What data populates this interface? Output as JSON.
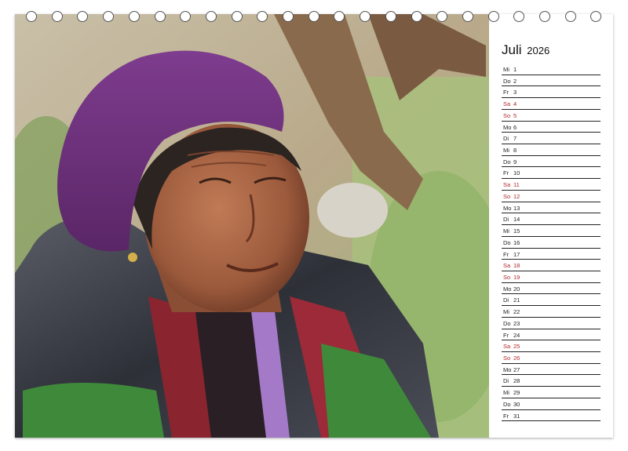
{
  "calendar": {
    "month": "Juli",
    "year": "2026",
    "days": [
      {
        "dn": "Mi",
        "d": "1",
        "weekend": false
      },
      {
        "dn": "Do",
        "d": "2",
        "weekend": false
      },
      {
        "dn": "Fr",
        "d": "3",
        "weekend": false
      },
      {
        "dn": "Sa",
        "d": "4",
        "weekend": true
      },
      {
        "dn": "So",
        "d": "5",
        "weekend": true
      },
      {
        "dn": "Mo",
        "d": "6",
        "weekend": false
      },
      {
        "dn": "Di",
        "d": "7",
        "weekend": false
      },
      {
        "dn": "Mi",
        "d": "8",
        "weekend": false
      },
      {
        "dn": "Do",
        "d": "9",
        "weekend": false
      },
      {
        "dn": "Fr",
        "d": "10",
        "weekend": false
      },
      {
        "dn": "Sa",
        "d": "11",
        "weekend": true
      },
      {
        "dn": "So",
        "d": "12",
        "weekend": true
      },
      {
        "dn": "Mo",
        "d": "13",
        "weekend": false
      },
      {
        "dn": "Di",
        "d": "14",
        "weekend": false
      },
      {
        "dn": "Mi",
        "d": "15",
        "weekend": false
      },
      {
        "dn": "Do",
        "d": "16",
        "weekend": false
      },
      {
        "dn": "Fr",
        "d": "17",
        "weekend": false
      },
      {
        "dn": "Sa",
        "d": "18",
        "weekend": true
      },
      {
        "dn": "So",
        "d": "19",
        "weekend": true
      },
      {
        "dn": "Mo",
        "d": "20",
        "weekend": false
      },
      {
        "dn": "Di",
        "d": "21",
        "weekend": false
      },
      {
        "dn": "Mi",
        "d": "22",
        "weekend": false
      },
      {
        "dn": "Do",
        "d": "23",
        "weekend": false
      },
      {
        "dn": "Fr",
        "d": "24",
        "weekend": false
      },
      {
        "dn": "Sa",
        "d": "25",
        "weekend": true
      },
      {
        "dn": "So",
        "d": "26",
        "weekend": true
      },
      {
        "dn": "Mo",
        "d": "27",
        "weekend": false
      },
      {
        "dn": "Di",
        "d": "28",
        "weekend": false
      },
      {
        "dn": "Mi",
        "d": "29",
        "weekend": false
      },
      {
        "dn": "Do",
        "d": "30",
        "weekend": false
      },
      {
        "dn": "Fr",
        "d": "31",
        "weekend": false
      }
    ]
  },
  "colors": {
    "weekend": "#b0282a",
    "text": "#222222",
    "hat": "#6e2f7c",
    "jacket": "#3b3d46",
    "sweater": "#3f8a3a"
  },
  "photo": {
    "subject_icon": "portrait-photo"
  }
}
